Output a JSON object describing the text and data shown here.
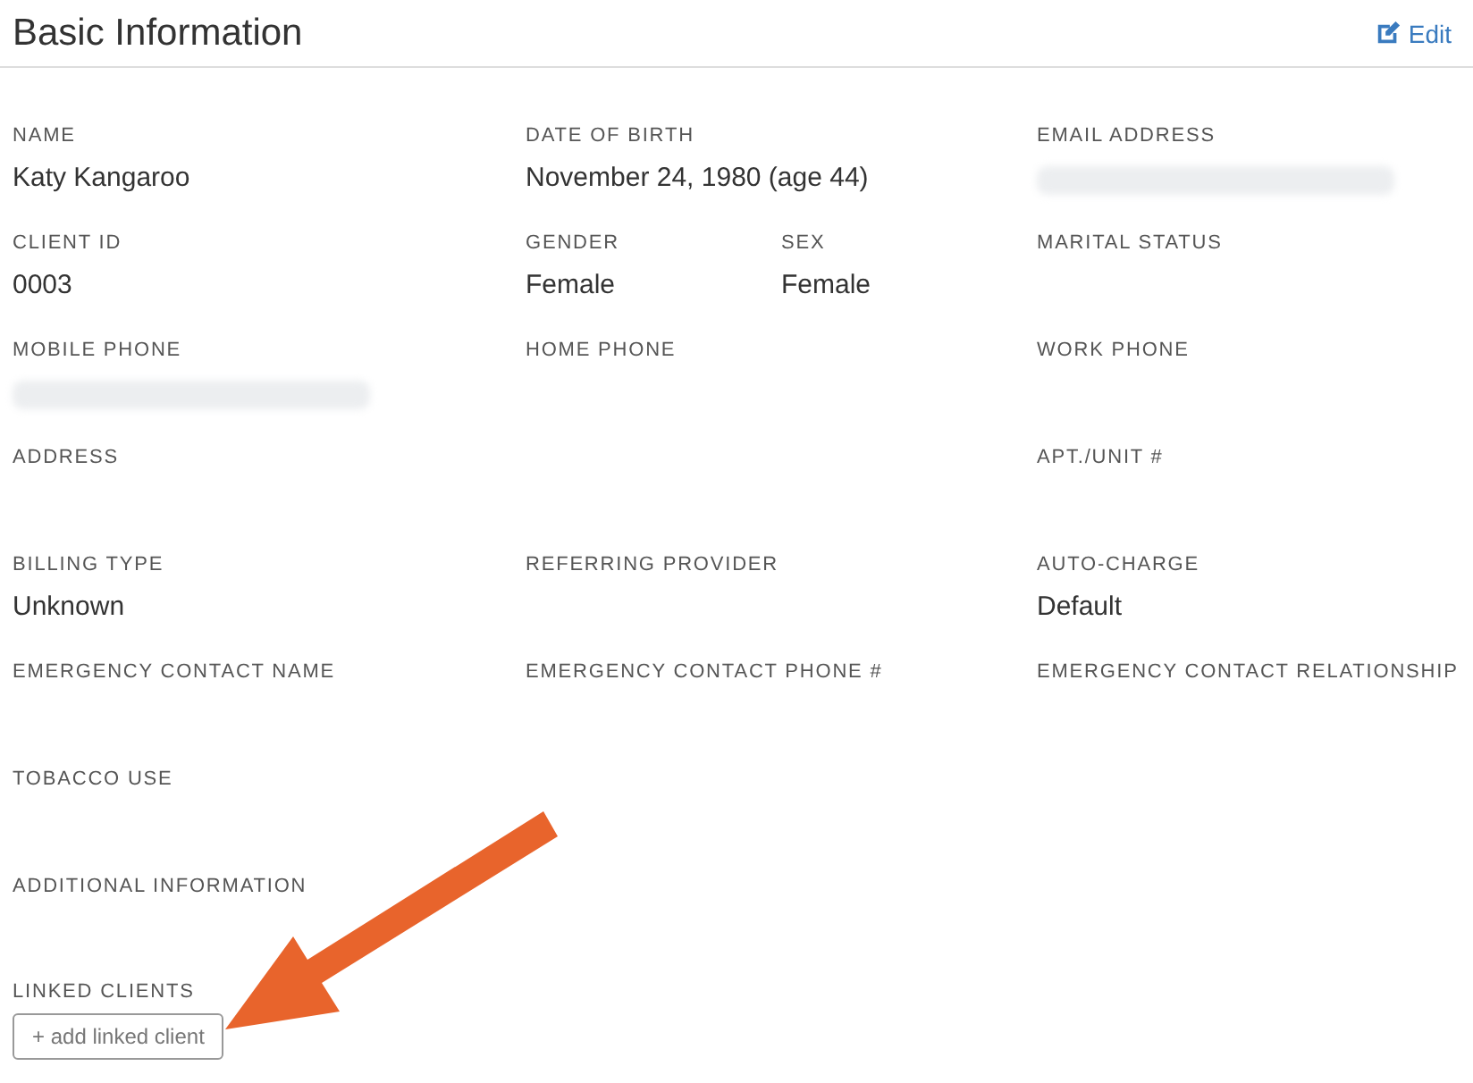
{
  "header": {
    "title": "Basic Information",
    "edit_link": "Edit"
  },
  "rows": [
    [
      {
        "label": "NAME",
        "value": "Katy Kangaroo"
      },
      {
        "label": "DATE OF BIRTH",
        "value": "November 24, 1980  (age 44)"
      },
      {
        "label": "EMAIL ADDRESS",
        "redacted": true
      }
    ],
    [
      {
        "label": "CLIENT ID",
        "value": "0003"
      },
      {
        "fields": [
          {
            "label": "GENDER",
            "value": "Female"
          },
          {
            "label": "SEX",
            "value": "Female"
          }
        ]
      },
      {
        "label": "MARITAL STATUS"
      }
    ],
    [
      {
        "label": "MOBILE PHONE",
        "redacted": true
      },
      {
        "label": "HOME PHONE"
      },
      {
        "label": "WORK PHONE"
      }
    ],
    [
      {
        "label": "ADDRESS"
      },
      null,
      {
        "label": "APT./UNIT #"
      }
    ],
    [
      {
        "label": "BILLING TYPE",
        "value": "Unknown"
      },
      {
        "label": "REFERRING PROVIDER"
      },
      {
        "label": "AUTO-CHARGE",
        "value": "Default"
      }
    ],
    [
      {
        "label": "EMERGENCY CONTACT NAME"
      },
      {
        "label": "EMERGENCY CONTACT PHONE #"
      },
      {
        "label": "EMERGENCY CONTACT RELATIONSHIP"
      }
    ],
    [
      {
        "label": "TOBACCO USE"
      }
    ],
    [
      {
        "label": "ADDITIONAL INFORMATION"
      }
    ]
  ],
  "linked_clients": {
    "label": "LINKED CLIENTS",
    "button": "+ add linked client"
  }
}
